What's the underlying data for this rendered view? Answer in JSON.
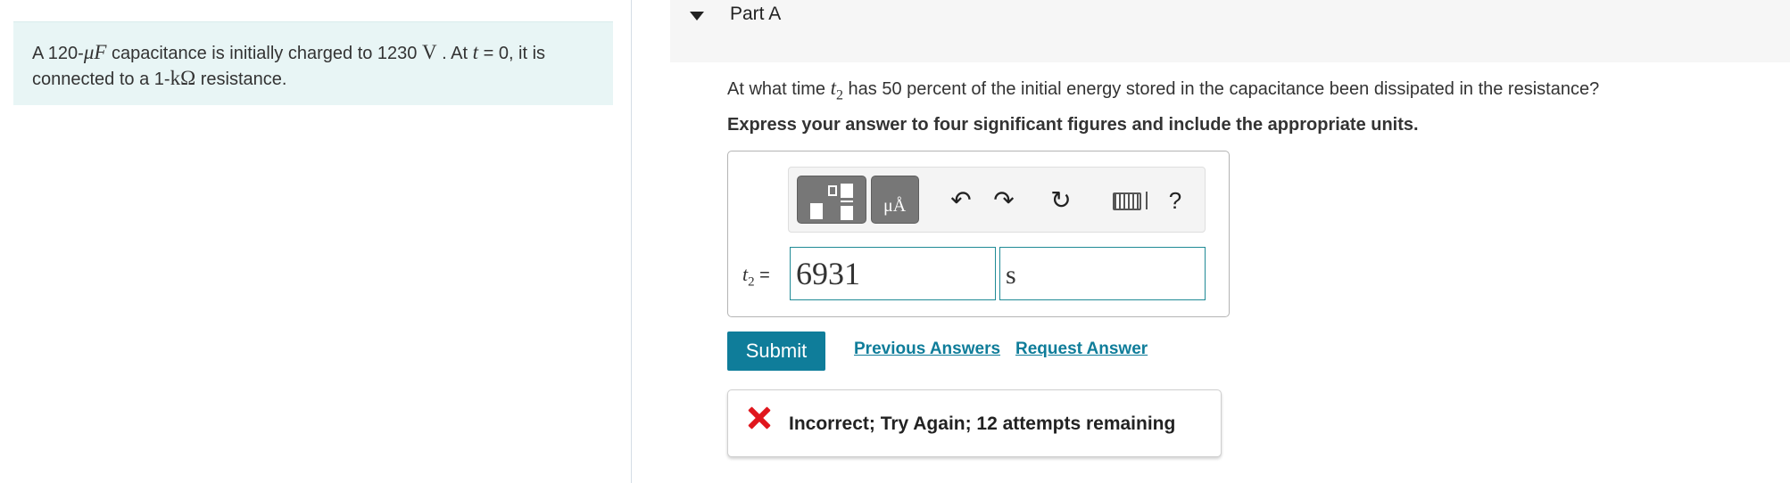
{
  "problem": {
    "p1": "A 120-",
    "mu_unit": "μF",
    "p2": " capacitance is initially charged to 1230 ",
    "v_unit": "V",
    "p3": " . At ",
    "t_var": "t",
    "p4": " = 0, it is connected to a 1-",
    "k_unit": "kΩ",
    "p5": " resistance."
  },
  "part": {
    "title": "Part A"
  },
  "question": {
    "q1": "At what time ",
    "var": "t",
    "sub": "2",
    "q2": " has 50 percent of the initial energy stored in the capacitance been dissipated in the resistance?"
  },
  "instruction": "Express your answer to four significant figures and include the appropriate units.",
  "toolbar": {
    "units_glyph": "μÅ",
    "undo": "↶",
    "redo": "↷",
    "reset": "↻",
    "help": "?"
  },
  "answer": {
    "label_var": "t",
    "label_sub": "2",
    "label_eq": " =",
    "value": "6931",
    "units": "s"
  },
  "actions": {
    "submit": "Submit",
    "previous_answers": "Previous Answers",
    "request_answer": "Request Answer"
  },
  "feedback": {
    "text": "Incorrect; Try Again; 12 attempts remaining"
  },
  "colors": {
    "accent": "#0f7d9a",
    "error": "#e0161d",
    "problem_bg": "#e8f5f5"
  }
}
